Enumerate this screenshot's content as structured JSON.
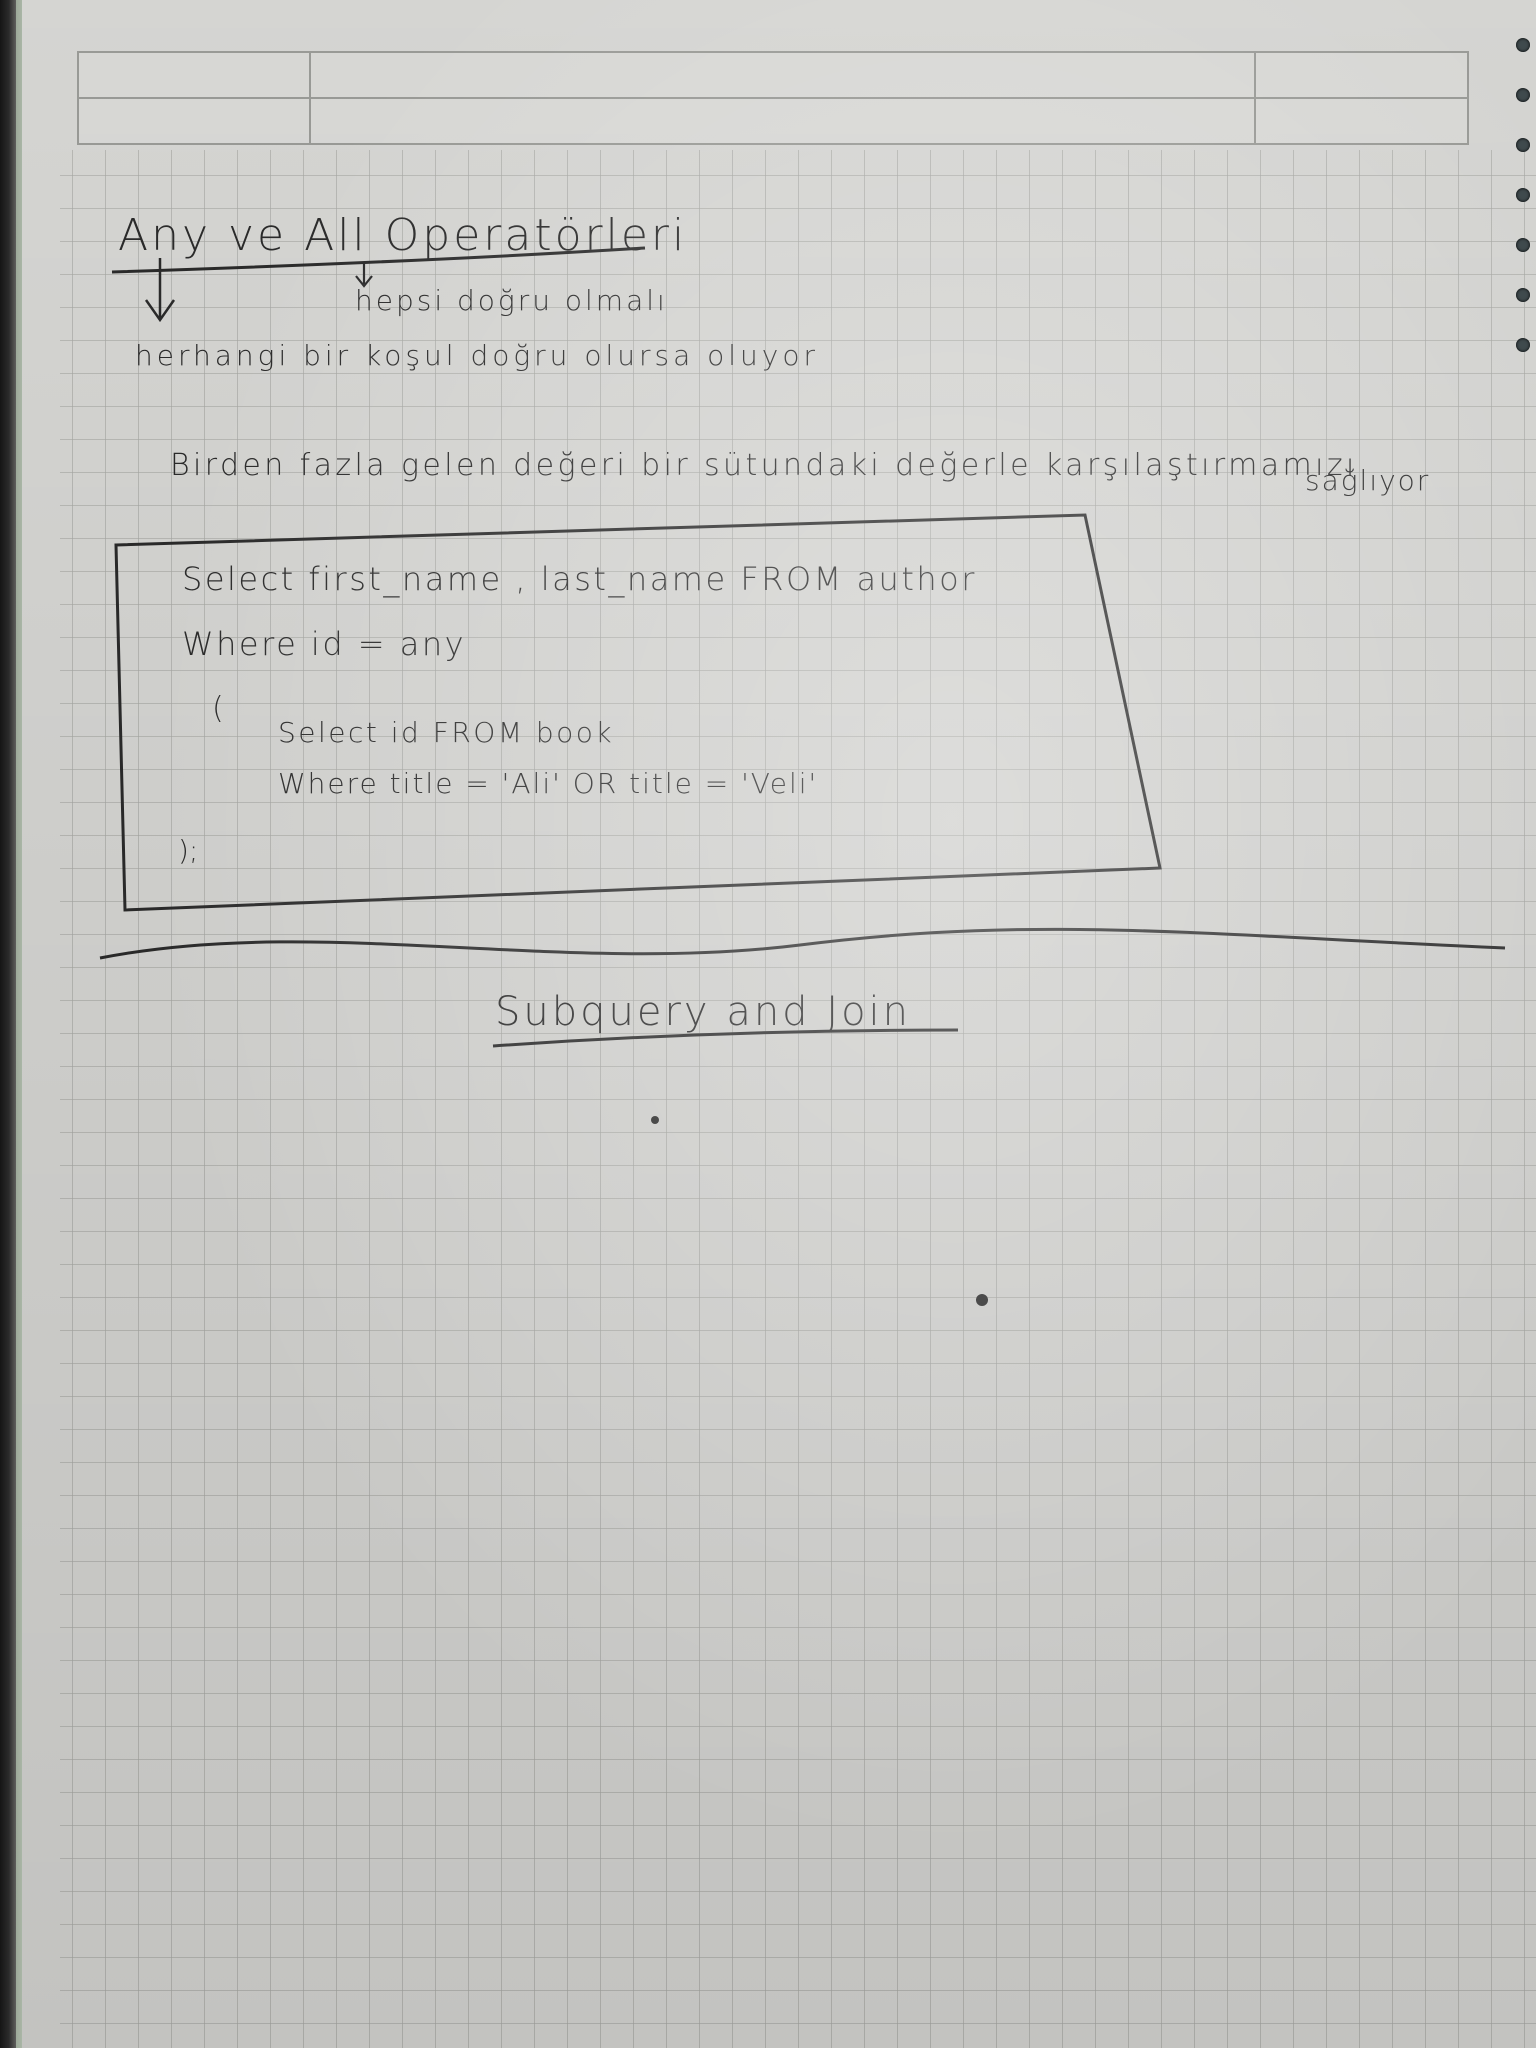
{
  "notes": {
    "title": "Any ve All Operatörleri",
    "note_all": "hepsi doğru olmalı",
    "note_any": "herhangi bir koşul doğru olursa oluyor",
    "description_line1": "Birden fazla gelen değeri bir sütundaki değerle karşılaştırmamızı",
    "description_line2": "sağlıyor",
    "code": {
      "line1": "Select first_name , last_name FROM author",
      "line2": "Where id = any",
      "line3": "(",
      "line4": "Select id FROM book",
      "line5": "Where title = 'Ali' OR title = 'Veli'",
      "line6": ");"
    },
    "section_heading": "Subquery and Join"
  },
  "colors": {
    "ink": "#2b2b2b",
    "paper": "#d9d9d6",
    "grid": "#a9aaa6"
  }
}
